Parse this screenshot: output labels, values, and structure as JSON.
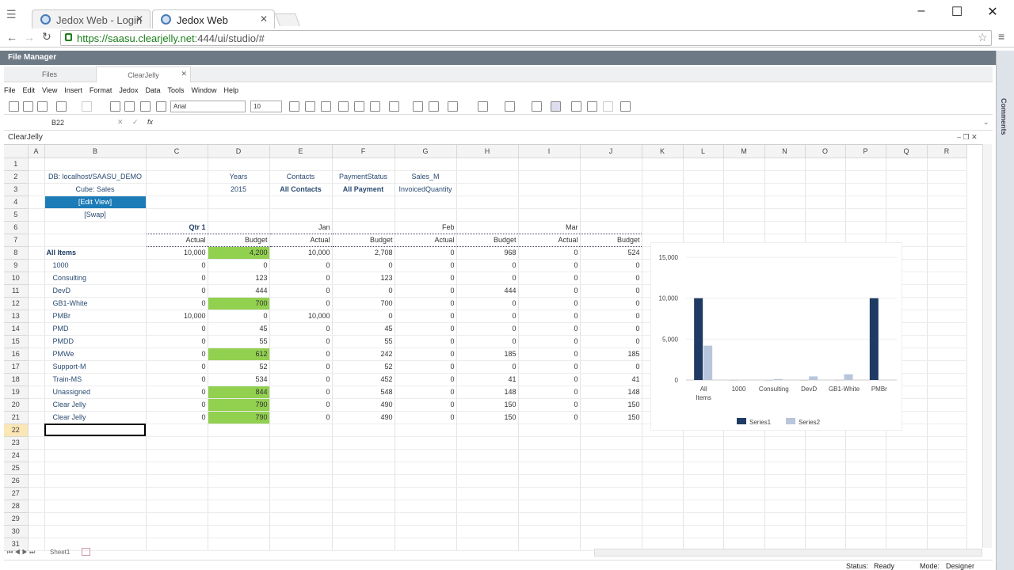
{
  "browser": {
    "tabs": [
      {
        "title": "Jedox Web - Login"
      },
      {
        "title": "Jedox Web"
      }
    ],
    "url_host": "https://saasu.clearjelly.net",
    "url_rest": ":444/ui/studio/#"
  },
  "app": {
    "panel_title": "File Manager",
    "tabs": [
      "Files",
      "ClearJelly"
    ],
    "right_strip_label": "Comments",
    "menu": [
      "File",
      "Edit",
      "View",
      "Insert",
      "Format",
      "Jedox",
      "Data",
      "Tools",
      "Window",
      "Help"
    ],
    "font": "Arial",
    "font_size": "10",
    "cell_ref": "B22",
    "fx": "fx",
    "sheet_title": "ClearJelly",
    "sheet_tab": "Sheet1"
  },
  "status": {
    "status_label": "Status:",
    "status_value": "Ready",
    "mode_label": "Mode:",
    "mode_value": "Designer"
  },
  "grid": {
    "columns": [
      "A",
      "B",
      "C",
      "D",
      "E",
      "F",
      "G",
      "H",
      "I",
      "J",
      "K",
      "L",
      "M",
      "N",
      "O",
      "P",
      "Q",
      "R"
    ],
    "rows": [
      {
        "r": "1",
        "c": [
          "",
          "",
          "",
          "",
          "",
          "",
          "",
          "",
          "",
          ""
        ]
      },
      {
        "r": "2",
        "c": [
          "",
          "DB: localhost/SAASU_DEMO",
          "",
          "Years",
          "Contacts",
          "PaymentStatus",
          "Sales_M",
          "",
          "",
          ""
        ]
      },
      {
        "r": "3",
        "c": [
          "",
          "Cube: Sales",
          "",
          "2015",
          "All Contacts",
          "All Payment",
          "InvoicedQuantity",
          "",
          "",
          ""
        ]
      },
      {
        "r": "4",
        "c": [
          "",
          "[Edit View]",
          "",
          "",
          "",
          "",
          "",
          "",
          "",
          ""
        ]
      },
      {
        "r": "5",
        "c": [
          "",
          "[Swap]",
          "",
          "",
          "",
          "",
          "",
          "",
          "",
          ""
        ]
      },
      {
        "r": "6",
        "c": [
          "",
          "",
          "Qtr 1",
          "",
          "Jan",
          "",
          "Feb",
          "",
          "Mar",
          ""
        ]
      },
      {
        "r": "7",
        "c": [
          "",
          "",
          "Actual",
          "Budget",
          "Actual",
          "Budget",
          "Actual",
          "Budget",
          "Actual",
          "Budget"
        ]
      },
      {
        "r": "8",
        "c": [
          "",
          "All Items",
          "10,000",
          "4,200",
          "10,000",
          "2,708",
          "0",
          "968",
          "0",
          "524"
        ]
      },
      {
        "r": "9",
        "c": [
          "",
          "1000",
          "0",
          "0",
          "0",
          "0",
          "0",
          "0",
          "0",
          "0"
        ]
      },
      {
        "r": "10",
        "c": [
          "",
          "Consulting",
          "0",
          "123",
          "0",
          "123",
          "0",
          "0",
          "0",
          "0"
        ]
      },
      {
        "r": "11",
        "c": [
          "",
          "DevD",
          "0",
          "444",
          "0",
          "0",
          "0",
          "444",
          "0",
          "0"
        ]
      },
      {
        "r": "12",
        "c": [
          "",
          "GB1-White",
          "0",
          "700",
          "0",
          "700",
          "0",
          "0",
          "0",
          "0"
        ]
      },
      {
        "r": "13",
        "c": [
          "",
          "PMBr",
          "10,000",
          "0",
          "10,000",
          "0",
          "0",
          "0",
          "0",
          "0"
        ]
      },
      {
        "r": "14",
        "c": [
          "",
          "PMD",
          "0",
          "45",
          "0",
          "45",
          "0",
          "0",
          "0",
          "0"
        ]
      },
      {
        "r": "15",
        "c": [
          "",
          "PMDD",
          "0",
          "55",
          "0",
          "55",
          "0",
          "0",
          "0",
          "0"
        ]
      },
      {
        "r": "16",
        "c": [
          "",
          "PMWe",
          "0",
          "612",
          "0",
          "242",
          "0",
          "185",
          "0",
          "185"
        ]
      },
      {
        "r": "17",
        "c": [
          "",
          "Support-M",
          "0",
          "52",
          "0",
          "52",
          "0",
          "0",
          "0",
          "0"
        ]
      },
      {
        "r": "18",
        "c": [
          "",
          "Train-MS",
          "0",
          "534",
          "0",
          "452",
          "0",
          "41",
          "0",
          "41"
        ]
      },
      {
        "r": "19",
        "c": [
          "",
          "Unassigned",
          "0",
          "844",
          "0",
          "548",
          "0",
          "148",
          "0",
          "148"
        ]
      },
      {
        "r": "20",
        "c": [
          "",
          "Clear Jelly",
          "0",
          "790",
          "0",
          "490",
          "0",
          "150",
          "0",
          "150"
        ]
      },
      {
        "r": "21",
        "c": [
          "",
          "Clear Jelly",
          "0",
          "790",
          "0",
          "490",
          "0",
          "150",
          "0",
          "150"
        ]
      },
      {
        "r": "22",
        "c": [
          "",
          "",
          "",
          "",
          "",
          "",
          "",
          "",
          "",
          ""
        ]
      },
      {
        "r": "23",
        "c": [
          "",
          "",
          "",
          "",
          "",
          "",
          "",
          "",
          "",
          ""
        ]
      },
      {
        "r": "24",
        "c": [
          "",
          "",
          "",
          "",
          "",
          "",
          "",
          "",
          "",
          ""
        ]
      },
      {
        "r": "25",
        "c": [
          "",
          "",
          "",
          "",
          "",
          "",
          "",
          "",
          "",
          ""
        ]
      },
      {
        "r": "26",
        "c": [
          "",
          "",
          "",
          "",
          "",
          "",
          "",
          "",
          "",
          ""
        ]
      },
      {
        "r": "27",
        "c": [
          "",
          "",
          "",
          "",
          "",
          "",
          "",
          "",
          "",
          ""
        ]
      },
      {
        "r": "28",
        "c": [
          "",
          "",
          "",
          "",
          "",
          "",
          "",
          "",
          "",
          ""
        ]
      },
      {
        "r": "29",
        "c": [
          "",
          "",
          "",
          "",
          "",
          "",
          "",
          "",
          "",
          ""
        ]
      },
      {
        "r": "30",
        "c": [
          "",
          "",
          "",
          "",
          "",
          "",
          "",
          "",
          "",
          ""
        ]
      },
      {
        "r": "31",
        "c": [
          "",
          "",
          "",
          "",
          "",
          "",
          "",
          "",
          "",
          ""
        ]
      }
    ],
    "green_rows": [
      "8",
      "12",
      "16",
      "19",
      "20",
      "21"
    ]
  },
  "chart_data": {
    "type": "bar",
    "categories": [
      "All Items",
      "1000",
      "Consulting",
      "DevD",
      "GB1-White",
      "PMBr"
    ],
    "series": [
      {
        "name": "Series1",
        "values": [
          10000,
          0,
          0,
          0,
          0,
          10000
        ],
        "color": "#1f3b63"
      },
      {
        "name": "Series2",
        "values": [
          4200,
          0,
          123,
          444,
          700,
          0
        ],
        "color": "#b8c6dc"
      }
    ],
    "ylim": [
      0,
      15000
    ],
    "yticks": [
      "0",
      "5,000",
      "10,000",
      "15,000"
    ],
    "legend": "bottom",
    "grid": true
  }
}
